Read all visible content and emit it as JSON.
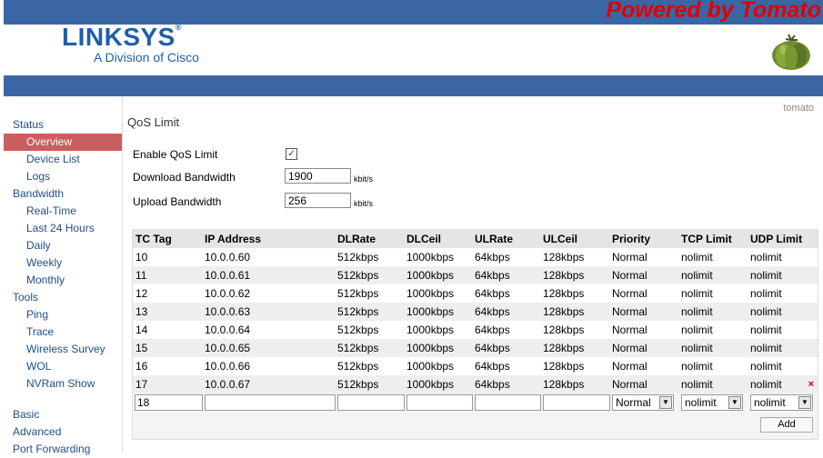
{
  "header": {
    "powered": "Powered by Tomato",
    "brand": "LINKSYS",
    "brand_mark": "®",
    "brand_sub": "A Division of Cisco",
    "router_name": "tomato"
  },
  "sidebar": {
    "items": [
      {
        "label": "Status",
        "level": 1
      },
      {
        "label": "Overview",
        "level": 2,
        "active": true
      },
      {
        "label": "Device List",
        "level": 2
      },
      {
        "label": "Logs",
        "level": 2
      },
      {
        "label": "Bandwidth",
        "level": 1
      },
      {
        "label": "Real-Time",
        "level": 2
      },
      {
        "label": "Last 24 Hours",
        "level": 2
      },
      {
        "label": "Daily",
        "level": 2
      },
      {
        "label": "Weekly",
        "level": 2
      },
      {
        "label": "Monthly",
        "level": 2
      },
      {
        "label": "Tools",
        "level": 1
      },
      {
        "label": "Ping",
        "level": 2
      },
      {
        "label": "Trace",
        "level": 2
      },
      {
        "label": "Wireless Survey",
        "level": 2
      },
      {
        "label": "WOL",
        "level": 2
      },
      {
        "label": "NVRam Show",
        "level": 2
      },
      {
        "label": "Basic",
        "level": 1
      },
      {
        "label": "Advanced",
        "level": 1
      },
      {
        "label": "Port Forwarding",
        "level": 1
      }
    ]
  },
  "page": {
    "title": "QoS Limit",
    "enable_label": "Enable QoS Limit",
    "enable_checked": true,
    "enable_check_glyph": "✓",
    "download_label": "Download Bandwidth",
    "download_value": "1900",
    "download_unit": "kbit/s",
    "upload_label": "Upload Bandwidth",
    "upload_value": "256",
    "upload_unit": "kbit/s"
  },
  "table": {
    "columns": [
      "TC Tag",
      "IP Address",
      "DLRate",
      "DLCeil",
      "ULRate",
      "ULCeil",
      "Priority",
      "TCP Limit",
      "UDP Limit"
    ],
    "rows": [
      [
        "10",
        "10.0.0.60",
        "512kbps",
        "1000kbps",
        "64kbps",
        "128kbps",
        "Normal",
        "nolimit",
        "nolimit"
      ],
      [
        "11",
        "10.0.0.61",
        "512kbps",
        "1000kbps",
        "64kbps",
        "128kbps",
        "Normal",
        "nolimit",
        "nolimit"
      ],
      [
        "12",
        "10.0.0.62",
        "512kbps",
        "1000kbps",
        "64kbps",
        "128kbps",
        "Normal",
        "nolimit",
        "nolimit"
      ],
      [
        "13",
        "10.0.0.63",
        "512kbps",
        "1000kbps",
        "64kbps",
        "128kbps",
        "Normal",
        "nolimit",
        "nolimit"
      ],
      [
        "14",
        "10.0.0.64",
        "512kbps",
        "1000kbps",
        "64kbps",
        "128kbps",
        "Normal",
        "nolimit",
        "nolimit"
      ],
      [
        "15",
        "10.0.0.65",
        "512kbps",
        "1000kbps",
        "64kbps",
        "128kbps",
        "Normal",
        "nolimit",
        "nolimit"
      ],
      [
        "16",
        "10.0.0.66",
        "512kbps",
        "1000kbps",
        "64kbps",
        "128kbps",
        "Normal",
        "nolimit",
        "nolimit"
      ],
      [
        "17",
        "10.0.0.67",
        "512kbps",
        "1000kbps",
        "64kbps",
        "128kbps",
        "Normal",
        "nolimit",
        "nolimit"
      ]
    ],
    "delete_glyph": "×",
    "edit_row": {
      "tc_tag": "18",
      "ip": "",
      "dlrate": "",
      "dlceil": "",
      "ulrate": "",
      "ulceil": "",
      "priority": "Normal",
      "tcp_limit": "nolimit",
      "udp_limit": "nolimit"
    },
    "dropdown_glyph": "▼",
    "add_label": "Add"
  },
  "colors": {
    "bar_blue": "#3a67a4",
    "powered_red": "#e00000",
    "brand_blue": "#1f5fa8",
    "nav_active": "#c95e5e"
  }
}
